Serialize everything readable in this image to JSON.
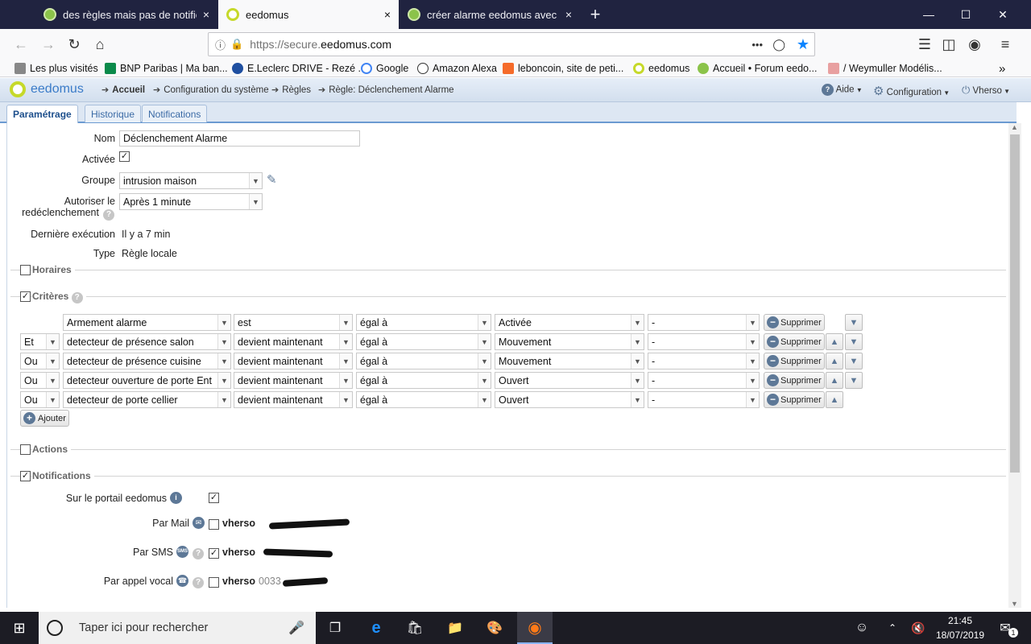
{
  "browser": {
    "tabs": [
      {
        "title": "des règles mais pas de notificat",
        "favicon_color": "#8bc34a"
      },
      {
        "title": "eedomus",
        "favicon_color": "#c6d92a"
      },
      {
        "title": "créer alarme eedomus avec pro",
        "favicon_color": "#8bc34a"
      }
    ],
    "new_tab": "+",
    "close_tab": "×",
    "url_scheme": "https://secure.",
    "url_host": "eedomus.com",
    "url_more": "•••",
    "bookmarks": [
      "Les plus visités",
      "BNP Paribas | Ma ban...",
      "E.Leclerc DRIVE - Rezé ...",
      "Google",
      "Amazon Alexa",
      "leboncoin, site de peti...",
      "eedomus",
      "Accueil • Forum eedo...",
      "/ Weymuller Modélis..."
    ]
  },
  "app": {
    "logo": "eedomus",
    "breadcrumb": [
      "Accueil",
      "Configuration du système",
      "Règles",
      "Règle: Déclenchement Alarme"
    ],
    "menu_help": "Aide",
    "menu_config": "Configuration",
    "menu_user": "Vherso",
    "subtabs": [
      "Paramétrage",
      "Historique",
      "Notifications"
    ]
  },
  "form": {
    "nom_label": "Nom",
    "nom_value": "Déclenchement Alarme",
    "activee_label": "Activée",
    "groupe_label": "Groupe",
    "groupe_value": "intrusion maison",
    "autoriser_label_1": "Autoriser le",
    "autoriser_label_2": "redéclenchement",
    "autoriser_value": "Après 1 minute",
    "derniere_label": "Dernière exécution",
    "derniere_value": "Il y a 7 min",
    "type_label": "Type",
    "type_value": "Règle locale"
  },
  "sections": {
    "horaires": "Horaires",
    "criteres": "Critères",
    "actions": "Actions",
    "notifications": "Notifications"
  },
  "criteria": {
    "rows": [
      {
        "op": "",
        "device": "Armement alarme",
        "verb": "est",
        "cmp": "égal à",
        "value": "Activée",
        "extra": "-"
      },
      {
        "op": "Et",
        "device": "detecteur de présence salon",
        "verb": "devient maintenant",
        "cmp": "égal à",
        "value": "Mouvement",
        "extra": "-"
      },
      {
        "op": "Ou",
        "device": "detecteur de présence cuisine",
        "verb": "devient maintenant",
        "cmp": "égal à",
        "value": "Mouvement",
        "extra": "-"
      },
      {
        "op": "Ou",
        "device": "detecteur ouverture de porte Ent",
        "verb": "devient maintenant",
        "cmp": "égal à",
        "value": "Ouvert",
        "extra": "-"
      },
      {
        "op": "Ou",
        "device": "detecteur de porte cellier",
        "verb": "devient maintenant",
        "cmp": "égal à",
        "value": "Ouvert",
        "extra": "-"
      }
    ],
    "delete_label": "Supprimer",
    "add_label": "Ajouter"
  },
  "notif": {
    "portail_label": "Sur le portail eedomus",
    "mail_label": "Par Mail",
    "sms_label": "Par SMS",
    "vocal_label": "Par appel vocal",
    "user": "vherso",
    "vocal_prefix": "0033",
    "sms_icon": "SMS"
  },
  "taskbar": {
    "search_placeholder": "Taper ici pour rechercher",
    "time": "21:45",
    "date": "18/07/2019",
    "notif_count": "1"
  }
}
